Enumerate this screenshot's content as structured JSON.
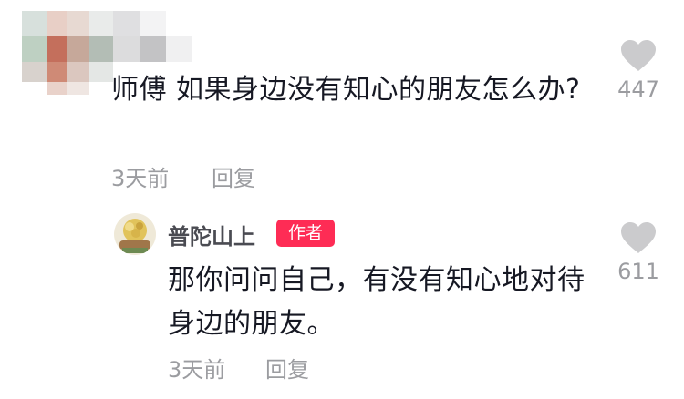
{
  "comment": {
    "text": "师傅 如果身边没有知心的朋友怎么办?",
    "time": "3天前",
    "reply_label": "回复",
    "like_count": "447"
  },
  "reply": {
    "username": "普陀山上",
    "author_badge": "作者",
    "text": "那你问问自己，有没有知心地对待身边的朋友。",
    "time": "3天前",
    "reply_label": "回复",
    "like_count": "611"
  },
  "colors": {
    "text_primary": "#161823",
    "text_secondary": "#9b9ca0",
    "badge": "#fe2c55",
    "heart": "#cbcbcd"
  },
  "icons": {
    "like": "heart-icon"
  }
}
